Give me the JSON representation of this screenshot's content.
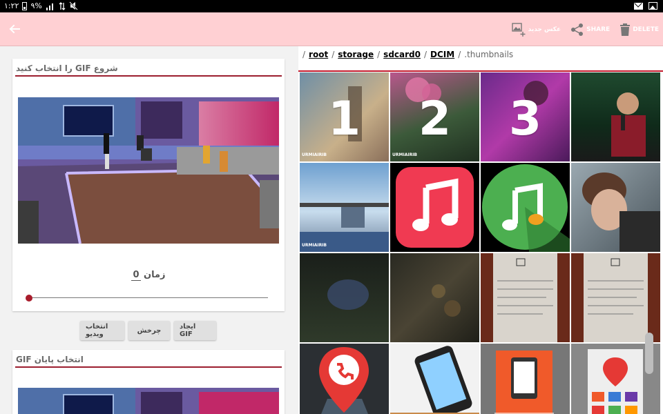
{
  "status_bar": {
    "time": "۱:۲۲",
    "battery": "۹%",
    "icons": [
      "mute-icon",
      "signal-icon",
      "battery-icon",
      "mail-icon",
      "image-icon"
    ]
  },
  "app_bar": {
    "back_icon": "arrow-left-icon",
    "actions": [
      {
        "name": "new-photo",
        "label": "عکس جدید",
        "icon": "add-image-icon"
      },
      {
        "name": "share",
        "label": "SHARE",
        "icon": "share-icon"
      },
      {
        "name": "delete",
        "label": "DELETE",
        "icon": "trash-icon"
      }
    ],
    "bg_color": "#ffd0d3"
  },
  "left_panel": {
    "start_card": {
      "title": "شروع GIF را انتخاب کنید",
      "time_label": "زمان",
      "time_value": "0",
      "slider_position": 0
    },
    "buttons": {
      "select_video": "انتخاب ویدیو",
      "rotate": "چرخش",
      "create_gif": "ایجاد GIF"
    },
    "end_card": {
      "title": "انتخاب پایان GIF"
    },
    "accent_color": "#9b1d2e"
  },
  "right_panel": {
    "breadcrumb": [
      "root",
      "storage",
      "sdcard0",
      "DCIM",
      ".thumbnails"
    ],
    "separator": "/",
    "thumbnails": [
      {
        "label": "1",
        "watermark": "URMIAIRIB"
      },
      {
        "label": "2",
        "watermark": "URMIAIRIB"
      },
      {
        "label": "3",
        "watermark": ""
      },
      {
        "label": "",
        "watermark": ""
      },
      {
        "label": "",
        "watermark": "URMIAIRIB"
      },
      {
        "label": "",
        "watermark": "",
        "icon": "music-app-icon-red"
      },
      {
        "label": "",
        "watermark": "",
        "icon": "music-app-icon-green"
      },
      {
        "label": "",
        "watermark": ""
      },
      {
        "label": "",
        "watermark": ""
      },
      {
        "label": "",
        "watermark": ""
      },
      {
        "label": "",
        "watermark": ""
      },
      {
        "label": "",
        "watermark": ""
      },
      {
        "label": "",
        "watermark": "",
        "icon": "phone-location-icon"
      },
      {
        "label": "",
        "watermark": ""
      },
      {
        "label": "",
        "watermark": ""
      },
      {
        "label": "",
        "watermark": ""
      }
    ],
    "accent_color": "#c2182b"
  }
}
